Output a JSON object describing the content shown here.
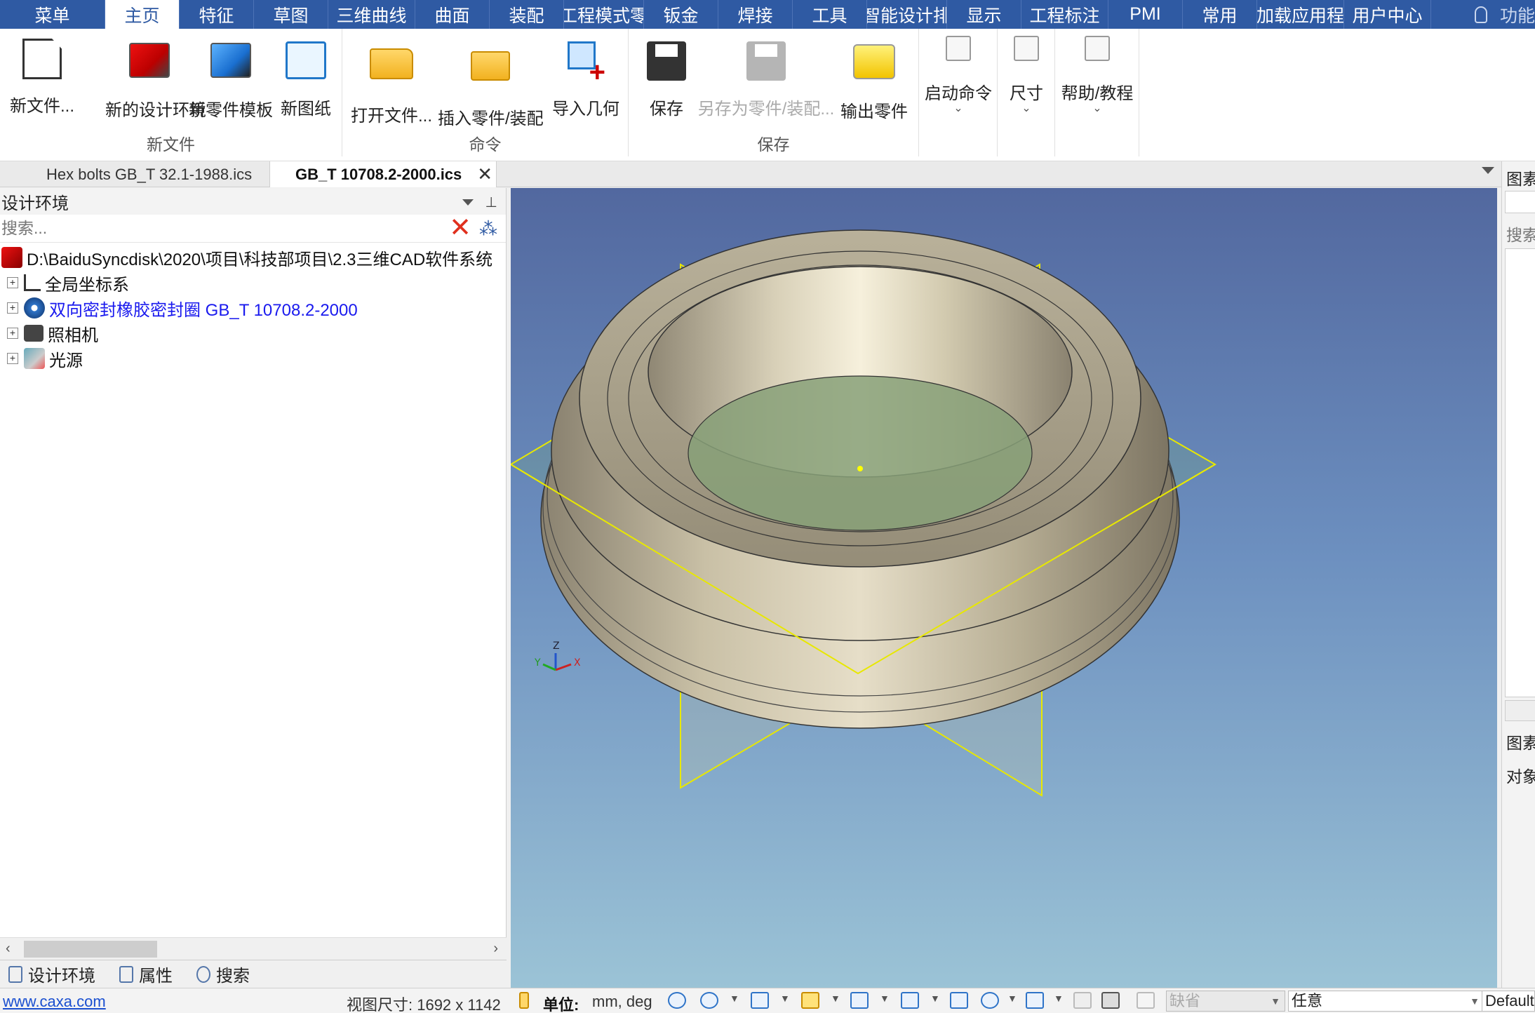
{
  "menubar": {
    "tabs": [
      "菜单",
      "主页",
      "特征",
      "草图",
      "三维曲线",
      "曲面",
      "装配",
      "工程模式零",
      "钣金",
      "焊接",
      "工具",
      "智能设计排",
      "显示",
      "工程标注",
      "PMI",
      "常用",
      "加载应用程",
      "用户中心"
    ],
    "active_tab": "主页",
    "feature_search": "功能"
  },
  "ribbon": {
    "groups": [
      {
        "title": "新文件",
        "buttons": [
          "新文件...",
          "新的设计环境",
          "新零件模板",
          "新图纸"
        ]
      },
      {
        "title": "命令",
        "buttons": [
          "打开文件...",
          "插入零件/装配",
          "导入几何"
        ]
      },
      {
        "title": "保存",
        "buttons": [
          "保存",
          "另存为零件/装配...",
          "输出零件"
        ]
      },
      {
        "title": "",
        "buttons": [
          "启动命令"
        ]
      },
      {
        "title": "",
        "buttons": [
          "尺寸"
        ]
      },
      {
        "title": "",
        "buttons": [
          "帮助/教程"
        ]
      }
    ]
  },
  "doc_tabs": [
    {
      "label": "Hex bolts GB_T 32.1-1988.ics",
      "active": false
    },
    {
      "label": "GB_T 10708.2-2000.ics",
      "active": true
    }
  ],
  "left_panel": {
    "title": "设计环境",
    "search_placeholder": "搜索...",
    "tree": [
      {
        "label": "D:\\BaiduSyncdisk\\2020\\项目\\科技部项目\\2.3三维CAD软件系统",
        "icon": "design-env-icon",
        "root": true
      },
      {
        "label": "全局坐标系",
        "icon": "axis-icon"
      },
      {
        "label": "双向密封橡胶密封圈 GB_T 10708.2-2000",
        "icon": "part-gear-icon",
        "highlight": true
      },
      {
        "label": "照相机",
        "icon": "camera-icon"
      },
      {
        "label": "光源",
        "icon": "light-icon"
      }
    ],
    "bottom_tabs": [
      "设计环境",
      "属性",
      "搜索"
    ]
  },
  "viewport": {
    "triad": {
      "x": "X",
      "y": "Y",
      "z": "Z"
    }
  },
  "right_panel": {
    "title": "图素",
    "search_label": "搜索",
    "mid_label": "图素",
    "bottom_label": "对象"
  },
  "statusbar": {
    "website": "www.caxa.com",
    "view_size": "视图尺寸: 1692 x 1142",
    "unit_label": "单位:",
    "unit_value": "mm, deg",
    "combo_default": "缺省",
    "combo_any": "任意",
    "combo_end": "Default"
  },
  "colors": {
    "menubar_bg": "#2f5aa3",
    "viewport_top": "#52689f",
    "viewport_bottom": "#9bc3d6",
    "plane_lines": "#e8e800",
    "tree_highlight": "#1a1aee"
  }
}
